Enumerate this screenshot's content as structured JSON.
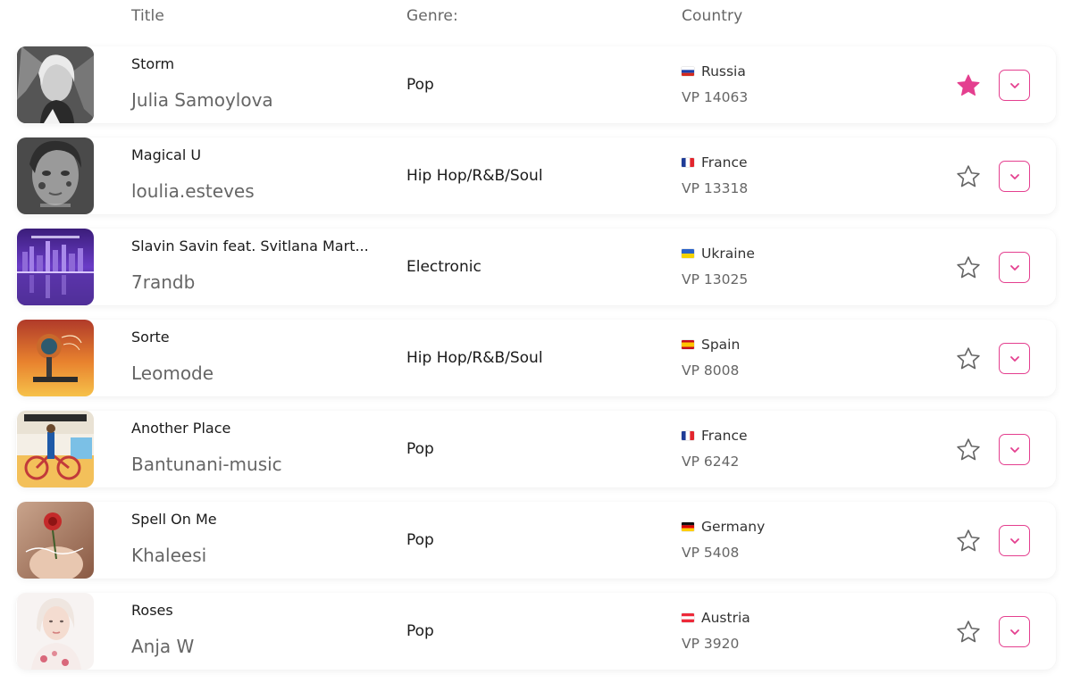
{
  "header": {
    "title": "Title",
    "genre": "Genre:",
    "country": "Country"
  },
  "accent_color": "#e43f8f",
  "rows": [
    {
      "title": "Storm",
      "artist": "Julia Samoylova",
      "genre": "Pop",
      "country": "Russia",
      "flag": "russia-flag-icon",
      "vp": "VP 14063",
      "starred": true
    },
    {
      "title": "Magical U",
      "artist": "loulia.esteves",
      "genre": "Hip Hop/R&B/Soul",
      "country": "France",
      "flag": "france-flag-icon",
      "vp": "VP 13318",
      "starred": false
    },
    {
      "title": "Slavin Savin feat. Svitlana Mart...",
      "artist": "7randb",
      "genre": "Electronic",
      "country": "Ukraine",
      "flag": "ukraine-flag-icon",
      "vp": "VP 13025",
      "starred": false
    },
    {
      "title": "Sorte",
      "artist": "Leomode",
      "genre": "Hip Hop/R&B/Soul",
      "country": "Spain",
      "flag": "spain-flag-icon",
      "vp": "VP 8008",
      "starred": false
    },
    {
      "title": "Another Place",
      "artist": "Bantunani-music",
      "genre": "Pop",
      "country": "France",
      "flag": "france-flag-icon",
      "vp": "VP 6242",
      "starred": false
    },
    {
      "title": "Spell On Me",
      "artist": "Khaleesi",
      "genre": "Pop",
      "country": "Germany",
      "flag": "germany-flag-icon",
      "vp": "VP 5408",
      "starred": false
    },
    {
      "title": "Roses",
      "artist": "Anja W",
      "genre": "Pop",
      "country": "Austria",
      "flag": "austria-flag-icon",
      "vp": "VP 3920",
      "starred": false
    }
  ]
}
